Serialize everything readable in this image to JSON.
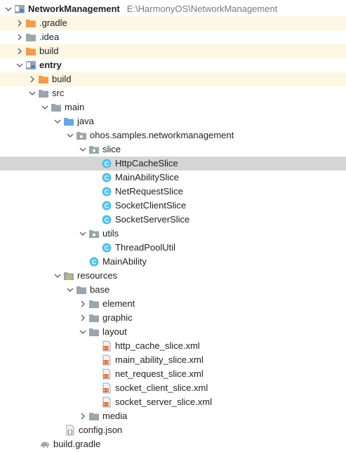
{
  "project": {
    "name": "NetworkManagement",
    "path": "E:\\HarmonyOS\\NetworkManagement"
  },
  "colors": {
    "folder_gray": "#9aa5ad",
    "folder_orange": "#f09c4a",
    "folder_blue": "#5fa8e6",
    "class_icon": "#4fc2e9",
    "xml_icon": "#e8703a",
    "selection": "#d5d5d5",
    "highlight_rows": "#fcf6e3"
  },
  "tree": [
    {
      "label": ".gradle",
      "icon": "folder-orange",
      "expanded": false
    },
    {
      "label": ".idea",
      "icon": "folder-gray",
      "expanded": false
    },
    {
      "label": "build",
      "icon": "folder-orange",
      "expanded": false
    },
    {
      "label": "entry",
      "icon": "module-folder",
      "expanded": true
    },
    {
      "label": "build",
      "icon": "folder-orange",
      "expanded": false
    },
    {
      "label": "src",
      "icon": "folder-gray",
      "expanded": true
    },
    {
      "label": "main",
      "icon": "folder-gray",
      "expanded": true
    },
    {
      "label": "java",
      "icon": "folder-blue",
      "expanded": true
    },
    {
      "label": "ohos.samples.networkmanagement",
      "icon": "package",
      "expanded": true
    },
    {
      "label": "slice",
      "icon": "package",
      "expanded": true
    },
    {
      "label": "HttpCacheSlice",
      "icon": "class",
      "selected": true
    },
    {
      "label": "MainAbilitySlice",
      "icon": "class"
    },
    {
      "label": "NetRequestSlice",
      "icon": "class"
    },
    {
      "label": "SocketClientSlice",
      "icon": "class"
    },
    {
      "label": "SocketServerSlice",
      "icon": "class"
    },
    {
      "label": "utils",
      "icon": "package",
      "expanded": true
    },
    {
      "label": "ThreadPoolUtil",
      "icon": "class"
    },
    {
      "label": "MainAbility",
      "icon": "class"
    },
    {
      "label": "resources",
      "icon": "resources-folder",
      "expanded": true
    },
    {
      "label": "base",
      "icon": "folder-gray",
      "expanded": true
    },
    {
      "label": "element",
      "icon": "folder-gray",
      "expanded": false
    },
    {
      "label": "graphic",
      "icon": "folder-gray",
      "expanded": false
    },
    {
      "label": "layout",
      "icon": "folder-gray",
      "expanded": true
    },
    {
      "label": "http_cache_slice.xml",
      "icon": "xml"
    },
    {
      "label": "main_ability_slice.xml",
      "icon": "xml"
    },
    {
      "label": "net_request_slice.xml",
      "icon": "xml"
    },
    {
      "label": "socket_client_slice.xml",
      "icon": "xml"
    },
    {
      "label": "socket_server_slice.xml",
      "icon": "xml"
    },
    {
      "label": "media",
      "icon": "folder-gray",
      "expanded": false
    },
    {
      "label": "config.json",
      "icon": "json"
    },
    {
      "label": "build.gradle",
      "icon": "gradle"
    }
  ]
}
